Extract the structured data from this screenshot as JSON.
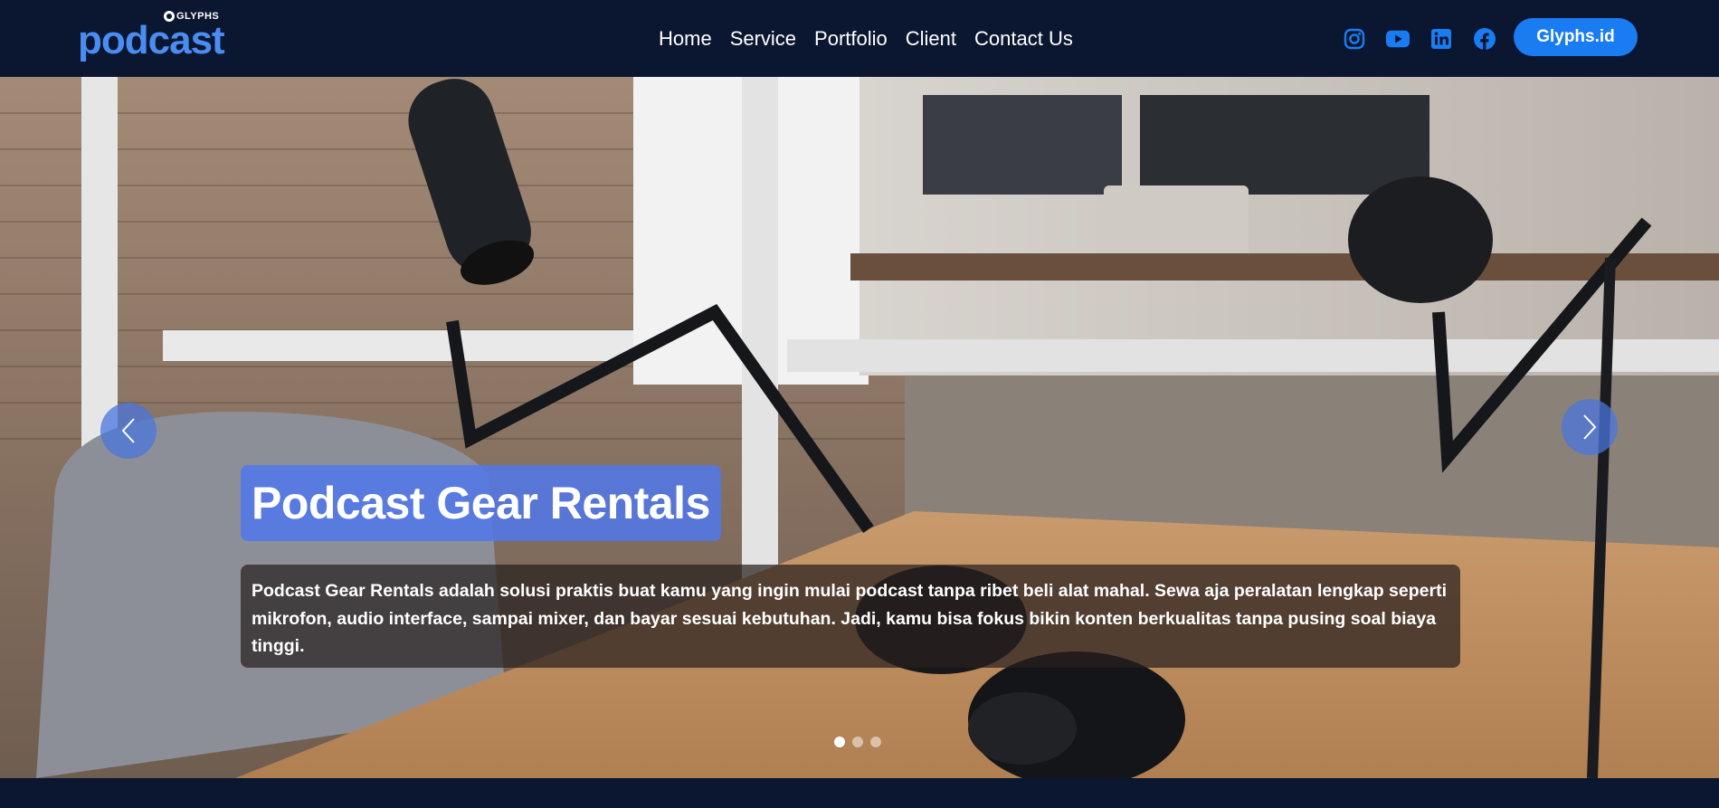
{
  "brand": {
    "small_label": "GLYPHS",
    "main_label": "podcast",
    "accent_color": "#4a8df2"
  },
  "nav": {
    "links": [
      "Home",
      "Service",
      "Portfolio",
      "Client",
      "Contact Us"
    ]
  },
  "social": {
    "icons": [
      "instagram-icon",
      "youtube-icon",
      "linkedin-icon",
      "facebook-icon"
    ],
    "icon_color": "#1a7cf2"
  },
  "cta": {
    "label": "Glyphs.id",
    "color": "#1a7cf2"
  },
  "hero": {
    "title": "Podcast Gear Rentals",
    "description": "Podcast Gear Rentals adalah solusi praktis buat kamu yang ingin mulai podcast tanpa ribet beli alat mahal. Sewa aja peralatan lengkap seperti mikrofon, audio interface, sampai mixer, dan bayar sesuai kebutuhan. Jadi, kamu bisa fokus bikin konten berkualitas tanpa pusing soal biaya tinggi.",
    "title_bg_color": "#5078eb",
    "slides_count": 3,
    "active_slide": 1
  },
  "theme": {
    "background": "#0b1630"
  }
}
